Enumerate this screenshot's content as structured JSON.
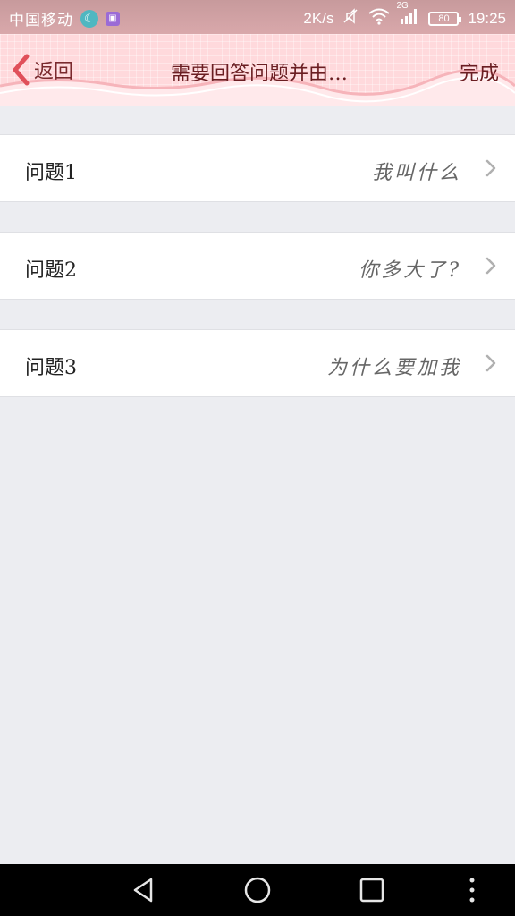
{
  "status_bar": {
    "carrier": "中国移动",
    "moon_icon": "moon-icon",
    "gallery_icon": "gallery-icon",
    "speed": "2K/s",
    "network_type": "2G",
    "battery": "80",
    "time": "19:25"
  },
  "nav": {
    "back_label": "返回",
    "title": "需要回答问题并由…",
    "done_label": "完成"
  },
  "questions": [
    {
      "label": "问题1",
      "value": "我叫什么"
    },
    {
      "label": "问题2",
      "value": "你多大了?"
    },
    {
      "label": "问题3",
      "value": "为什么要加我"
    }
  ],
  "colors": {
    "nav_background": "#FFD9DC",
    "title_text": "#6a1e22",
    "back_chevron": "#e0505a",
    "page_background": "#ECEDF1"
  }
}
